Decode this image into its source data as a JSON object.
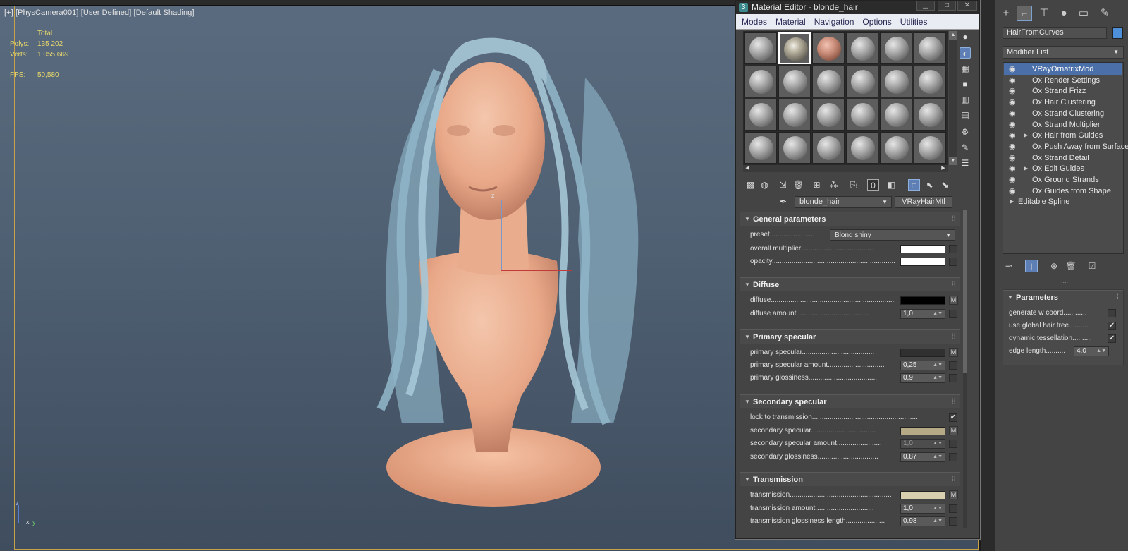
{
  "viewport": {
    "label": "[+] [PhysCamera001] [User Defined] [Default Shading]",
    "stats_header": "Total",
    "polys_label": "Polys:",
    "polys_value": "135 202",
    "verts_label": "Verts:",
    "verts_value": "1 055 669",
    "fps_label": "FPS:",
    "fps_value": "50,580",
    "axis_z": "z",
    "axis_x": "x",
    "axis_y": "y"
  },
  "material_editor": {
    "title": "Material Editor - blonde_hair",
    "app_icon": "3",
    "menu": [
      "Modes",
      "Material",
      "Navigation",
      "Options",
      "Utilities"
    ],
    "material_name": "blonde_hair",
    "material_type": "VRayHairMtl",
    "rollouts": {
      "general": {
        "title": "General parameters",
        "preset_label": "preset.......................",
        "preset_value": "Blond shiny",
        "overall_multiplier_label": "overall multiplier.....................................",
        "opacity_label": "opacity...............................................................",
        "overall_multiplier_color": "#ffffff",
        "opacity_color": "#ffffff"
      },
      "diffuse": {
        "title": "Diffuse",
        "diffuse_label": "diffuse...............................................................",
        "diffuse_color": "#000000",
        "diffuse_m": "M",
        "diffuse_amount_label": "diffuse amount.....................................",
        "diffuse_amount_value": "1,0"
      },
      "primary_specular": {
        "title": "Primary specular",
        "primary_specular_label": "primary specular.....................................",
        "primary_specular_color": "#303030",
        "primary_specular_m": "M",
        "primary_specular_amount_label": "primary specular amount.............................",
        "primary_specular_amount_value": "0,25",
        "primary_glossiness_label": "primary glossiness...................................",
        "primary_glossiness_value": "0,9"
      },
      "secondary_specular": {
        "title": "Secondary specular",
        "lock_label": "lock to transmission......................................................",
        "lock_checked": "✔",
        "secondary_specular_label": "secondary specular.................................",
        "secondary_specular_color": "#b5a986",
        "secondary_specular_m": "M",
        "secondary_specular_amount_label": "secondary specular amount.......................",
        "secondary_specular_amount_value": "1,0",
        "secondary_glossiness_label": "secondary glossiness...............................",
        "secondary_glossiness_value": "0,87"
      },
      "transmission": {
        "title": "Transmission",
        "transmission_label": "transmission....................................................",
        "transmission_color": "#d8cfae",
        "transmission_m": "M",
        "transmission_amount_label": "transmission amount..............................",
        "transmission_amount_value": "1,0",
        "transmission_glossiness_label": "transmission glossiness length....................",
        "transmission_glossiness_value": "0,98"
      }
    }
  },
  "command_panel": {
    "object_name": "HairFromCurves",
    "object_color": "#4d8fd8",
    "modifier_list": "Modifier List",
    "modifiers": [
      {
        "name": "VRayOrnatrixMod",
        "selected": true,
        "expandable": false
      },
      {
        "name": "Ox Render Settings",
        "selected": false,
        "expandable": false
      },
      {
        "name": "Ox Strand Frizz",
        "selected": false,
        "expandable": false
      },
      {
        "name": "Ox Hair Clustering",
        "selected": false,
        "expandable": false
      },
      {
        "name": "Ox Strand Clustering",
        "selected": false,
        "expandable": false
      },
      {
        "name": "Ox Strand Multiplier",
        "selected": false,
        "expandable": false
      },
      {
        "name": "Ox Hair from Guides",
        "selected": false,
        "expandable": true
      },
      {
        "name": "Ox Push Away from Surface",
        "selected": false,
        "expandable": false
      },
      {
        "name": "Ox Strand Detail",
        "selected": false,
        "expandable": false
      },
      {
        "name": "Ox Edit Guides",
        "selected": false,
        "expandable": true
      },
      {
        "name": "Ox Ground Strands",
        "selected": false,
        "expandable": false
      },
      {
        "name": "Ox Guides from Shape",
        "selected": false,
        "expandable": false
      }
    ],
    "base_object": "Editable Spline",
    "parameters": {
      "title": "Parameters",
      "generate_w_coord_label": "generate w coord............",
      "use_global_hair_tree_label": "use global hair tree..........",
      "use_global_hair_tree_checked": "✔",
      "dynamic_tessellation_label": "dynamic tessellation..........",
      "dynamic_tessellation_checked": "✔",
      "edge_length_label": "edge length..........",
      "edge_length_value": "4,0"
    }
  },
  "icons": {
    "create": "plus-icon",
    "modify": "modify-icon",
    "hierarchy": "hierarchy-icon",
    "motion": "motion-icon",
    "display": "display-icon",
    "utilities": "wrench-icon"
  }
}
